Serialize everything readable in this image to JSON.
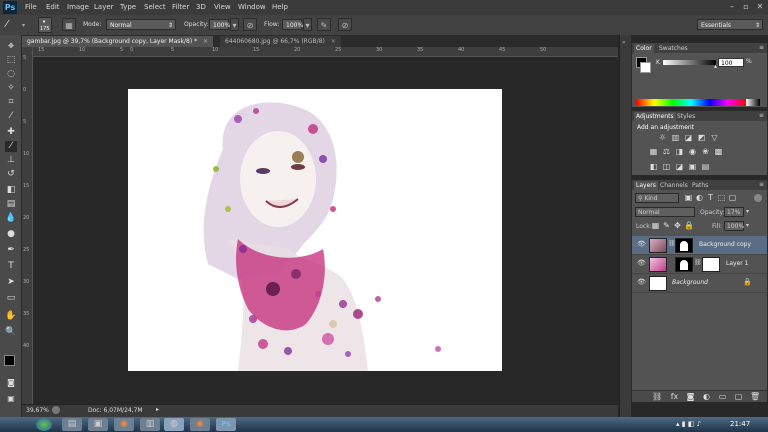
{
  "app": {
    "logo": "Ps"
  },
  "menu": [
    "File",
    "Edit",
    "Image",
    "Layer",
    "Type",
    "Select",
    "Filter",
    "3D",
    "View",
    "Window",
    "Help"
  ],
  "options": {
    "brush_size": "175",
    "mode_label": "Mode:",
    "mode_value": "Normal",
    "opacity_label": "Opacity:",
    "opacity_value": "100%",
    "flow_label": "Flow:",
    "flow_value": "100%",
    "workspace": "Essentials"
  },
  "tabs": [
    {
      "label": "gambar.jpg @ 39,7% (Background copy, Layer Mask/8) *"
    },
    {
      "label": "644060680.jpg @ 66,7% (RGB/8)"
    }
  ],
  "ruler_ticks": [
    "15",
    "10",
    "5",
    "0",
    "5",
    "10",
    "15",
    "20",
    "25",
    "30",
    "35",
    "40",
    "45",
    "50"
  ],
  "ruler_left_ticks": [
    "5",
    "0",
    "5",
    "10",
    "15",
    "20",
    "25",
    "30",
    "35",
    "40"
  ],
  "status": {
    "zoom": "39,67%",
    "doc": "Doc: 6,07M/24,7M"
  },
  "color_panel": {
    "tabs": [
      "Color",
      "Swatches"
    ],
    "k_label": "K",
    "k_value": "100"
  },
  "adjustments": {
    "tabs": [
      "Adjustments",
      "Styles"
    ],
    "title": "Add an adjustment"
  },
  "layers_panel": {
    "tabs": [
      "Layers",
      "Channels",
      "Paths"
    ],
    "kind": "Kind",
    "blend": "Normal",
    "opacity_label": "Opacity:",
    "opacity_value": "17%",
    "lock_label": "Lock:",
    "fill_label": "Fill:",
    "fill_value": "100%",
    "layers": [
      {
        "name": "Background copy",
        "selected": true
      },
      {
        "name": "Layer 1",
        "selected": false
      },
      {
        "name": "Background",
        "selected": false
      }
    ]
  },
  "taskbar": {
    "time": "21:47"
  },
  "colors": {
    "accent_selected": "#5a6d84",
    "ps_blue": "#6fb9f5"
  },
  "icons": [
    "brush-icon",
    "move-icon",
    "marquee-icon",
    "lasso-icon",
    "quick-select-icon",
    "crop-icon",
    "eyedropper-icon",
    "healing-icon",
    "brush-tool-icon",
    "stamp-icon",
    "history-brush-icon",
    "eraser-icon",
    "gradient-icon",
    "blur-icon",
    "dodge-icon",
    "pen-icon",
    "type-icon",
    "path-select-icon",
    "shape-icon",
    "hand-icon",
    "zoom-icon"
  ]
}
